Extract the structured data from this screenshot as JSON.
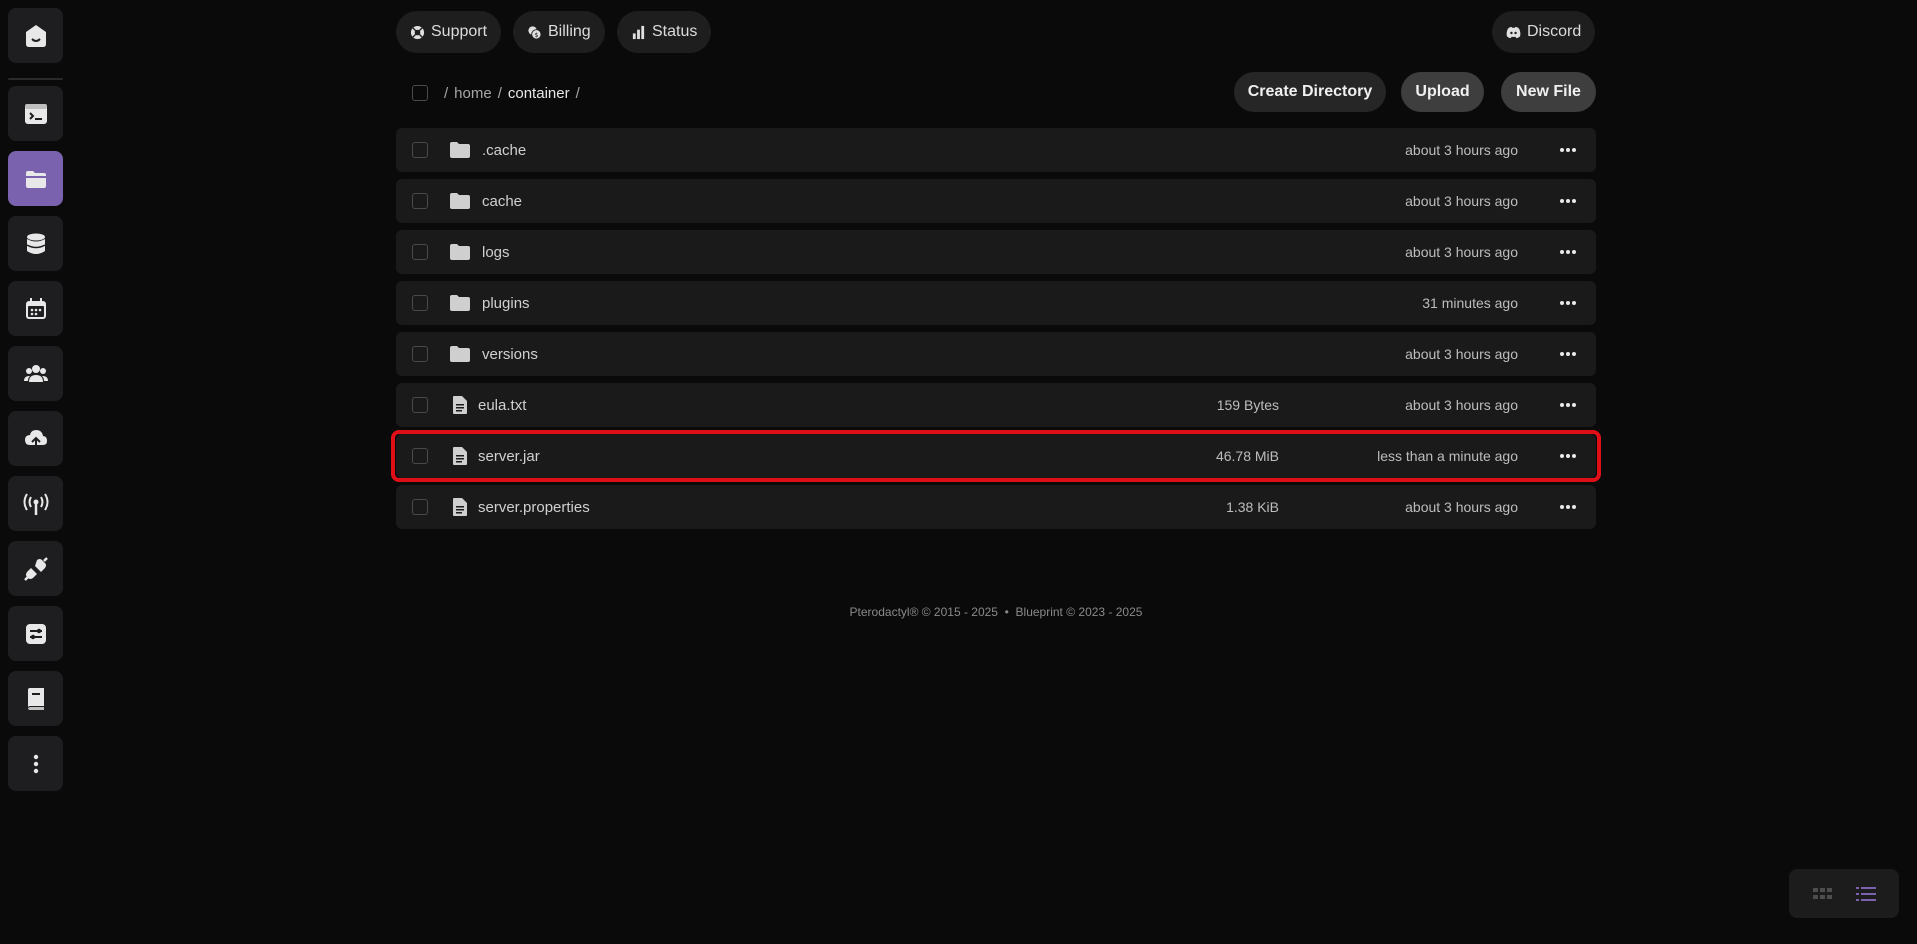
{
  "top_nav": {
    "support": "Support",
    "billing": "Billing",
    "status": "Status",
    "discord": "Discord"
  },
  "breadcrumb": {
    "root": "/",
    "home": "home",
    "sep1": "/",
    "container": "container",
    "sep2": "/"
  },
  "actions": {
    "create_directory": "Create Directory",
    "upload": "Upload",
    "new_file": "New File"
  },
  "files": [
    {
      "name": ".cache",
      "type": "folder",
      "size": "",
      "modified": "about 3 hours ago"
    },
    {
      "name": "cache",
      "type": "folder",
      "size": "",
      "modified": "about 3 hours ago"
    },
    {
      "name": "logs",
      "type": "folder",
      "size": "",
      "modified": "about 3 hours ago"
    },
    {
      "name": "plugins",
      "type": "folder",
      "size": "",
      "modified": "31 minutes ago"
    },
    {
      "name": "versions",
      "type": "folder",
      "size": "",
      "modified": "about 3 hours ago"
    },
    {
      "name": "eula.txt",
      "type": "file",
      "size": "159 Bytes",
      "modified": "about 3 hours ago"
    },
    {
      "name": "server.jar",
      "type": "file",
      "size": "46.78 MiB",
      "modified": "less than a minute ago"
    },
    {
      "name": "server.properties",
      "type": "file",
      "size": "1.38 KiB",
      "modified": "about 3 hours ago"
    }
  ],
  "footer": {
    "text": "Pterodactyl® © 2015 - 2025  •  Blueprint © 2023 - 2025"
  },
  "sidebar_icons": [
    "home-icon",
    "console-icon",
    "folder-icon",
    "database-icon",
    "schedule-icon",
    "users-icon",
    "backup-icon",
    "network-icon",
    "plugin-icon",
    "settings-icon",
    "docs-icon",
    "more-icon"
  ],
  "colors": {
    "active_sidebar": "#7a62ae",
    "highlight": "#e00f17",
    "background": "#0b0a0b"
  }
}
